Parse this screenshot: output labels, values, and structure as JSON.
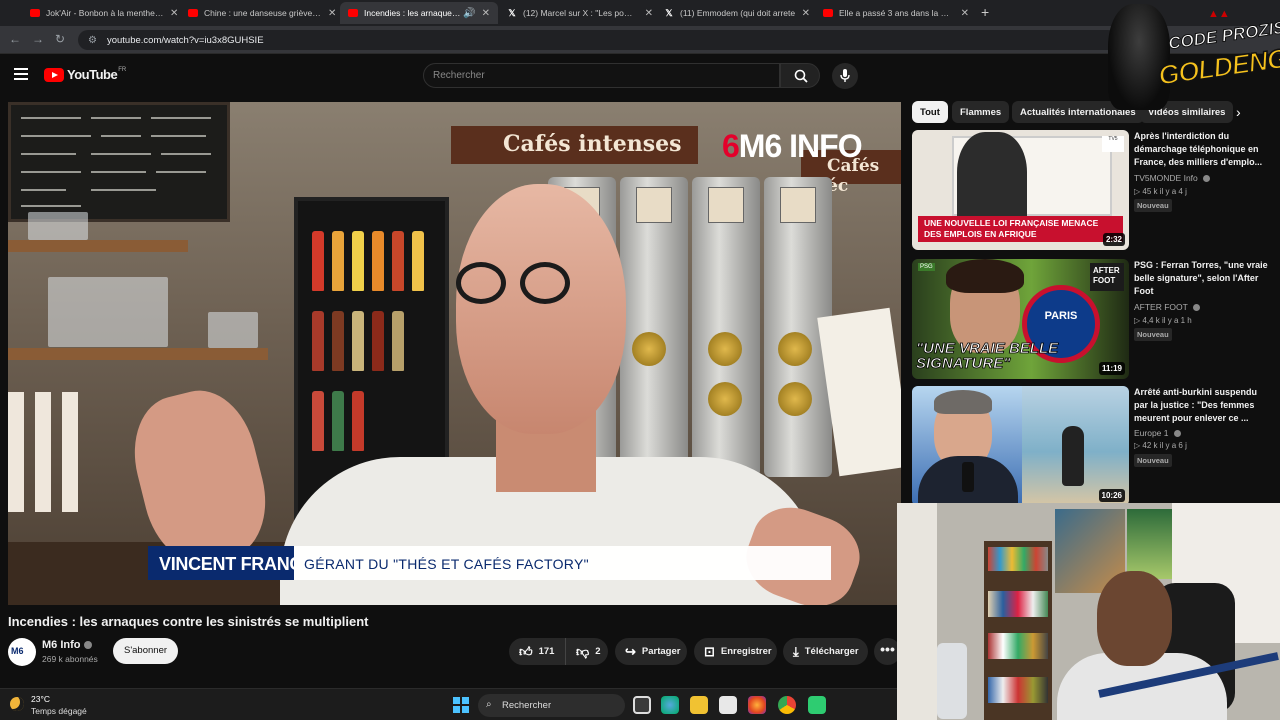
{
  "browser": {
    "tabs": [
      {
        "label": "Jok'Air - Bonbon à la menthe Fr",
        "icon": "youtube-icon",
        "active": false
      },
      {
        "label": "Chine : une danseuse grièveme",
        "icon": "youtube-icon",
        "active": false
      },
      {
        "label": "Incendies : les arnaques co",
        "icon": "youtube-icon",
        "active": true
      },
      {
        "label": "(12) Marcel sur X : \"Les pompie",
        "icon": "x-icon",
        "active": false
      },
      {
        "label": "(11) Emmodem (qui doit arrete",
        "icon": "x-icon",
        "active": false
      },
      {
        "label": "Elle a passé 3 ans dans la maiso",
        "icon": "youtube-icon",
        "active": false
      }
    ],
    "url": "youtube.com/watch?v=iu3x8GUHSIE"
  },
  "header": {
    "logo_text": "YouTube",
    "region": "FR",
    "search_placeholder": "Rechercher"
  },
  "video": {
    "channel_logo": "M6 INFO",
    "sign_main": "Cafés intenses",
    "sign_side": "Cafés éc",
    "lower_third_name": "VINCENT FRANCK",
    "lower_third_role": "GÉRANT DU \"THÉS ET CAFÉS FACTORY\"",
    "title": "Incendies : les arnaques contre les sinistrés se multiplient"
  },
  "channel": {
    "name": "M6 Info",
    "subscribers": "269 k abonnés",
    "subscribe_label": "S'abonner"
  },
  "actions": {
    "likes": "171",
    "dislikes": "2",
    "share": "Partager",
    "save": "Enregistrer",
    "download": "Télécharger",
    "more": "•••"
  },
  "sidebar": {
    "chips": [
      "Tout",
      "Flammes",
      "Actualités internationales",
      "Vidéos similaires"
    ],
    "recommendations": [
      {
        "title": "Après l'interdiction du démarchage téléphonique en France, des milliers d'emplo...",
        "channel": "TV5MONDE Info",
        "meta": "▷ 45 k  il y a 4 j",
        "badge": "Nouveau",
        "duration": "2:32",
        "thumb_caption": "UNE NOUVELLE LOI FRANÇAISE MENACE DES EMPLOIS EN AFRIQUE"
      },
      {
        "title": "PSG : Ferran Torres, \"une vraie belle signature\", selon l'After Foot",
        "channel": "AFTER FOOT",
        "meta": "▷ 4,4 k  il y a 1 h",
        "badge": "Nouveau",
        "duration": "11:19",
        "thumb_caption": "\"UNE VRAIE BELLE SIGNATURE\"",
        "thumb_tag": "AFTER FOOT",
        "thumb_small": "PSG",
        "thumb_crest": "PARIS"
      },
      {
        "title": "Arrêté anti-burkini suspendu par la justice : \"Des femmes meurent pour enlever ce ...",
        "channel": "Europe 1",
        "meta": "▷ 42 k  il y a 6 j",
        "badge": "Nouveau",
        "duration": "10:26"
      }
    ]
  },
  "overlay": {
    "streamer_logo_top": "CODE PROZIS",
    "streamer_logo_main": "GOLDENG"
  },
  "taskbar": {
    "temperature": "23°C",
    "condition": "Temps dégagé",
    "search_placeholder": "Rechercher"
  }
}
